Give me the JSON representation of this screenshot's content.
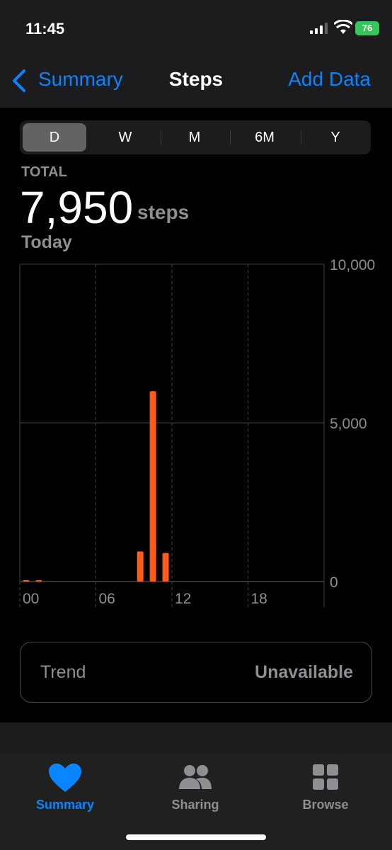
{
  "status_bar": {
    "time": "11:45",
    "battery": "76"
  },
  "nav": {
    "back_label": "Summary",
    "title": "Steps",
    "action_label": "Add Data"
  },
  "segments": [
    "D",
    "W",
    "M",
    "6M",
    "Y"
  ],
  "selected_segment": "D",
  "summary": {
    "total_label": "TOTAL",
    "value": "7,950",
    "unit": "steps",
    "date_label": "Today"
  },
  "chart_data": {
    "type": "bar",
    "x_ticks": [
      "00",
      "06",
      "12",
      "18"
    ],
    "y_ticks": [
      "10,000",
      "5,000",
      "0"
    ],
    "ylim": [
      0,
      10000
    ],
    "xlim": [
      0,
      24
    ],
    "hours": [
      0,
      1,
      9,
      10,
      11
    ],
    "values": [
      20,
      40,
      950,
      6000,
      900
    ],
    "color": "#ff5a1f"
  },
  "trend": {
    "label": "Trend",
    "value": "Unavailable"
  },
  "tabbar": {
    "items": [
      {
        "label": "Summary",
        "icon": "heart-icon",
        "active": true
      },
      {
        "label": "Sharing",
        "icon": "people-icon",
        "active": false
      },
      {
        "label": "Browse",
        "icon": "grid-icon",
        "active": false
      }
    ]
  },
  "colors": {
    "accent": "#0a84ff",
    "bar": "#ff5a1f",
    "secondary_text": "#8e8e93"
  }
}
